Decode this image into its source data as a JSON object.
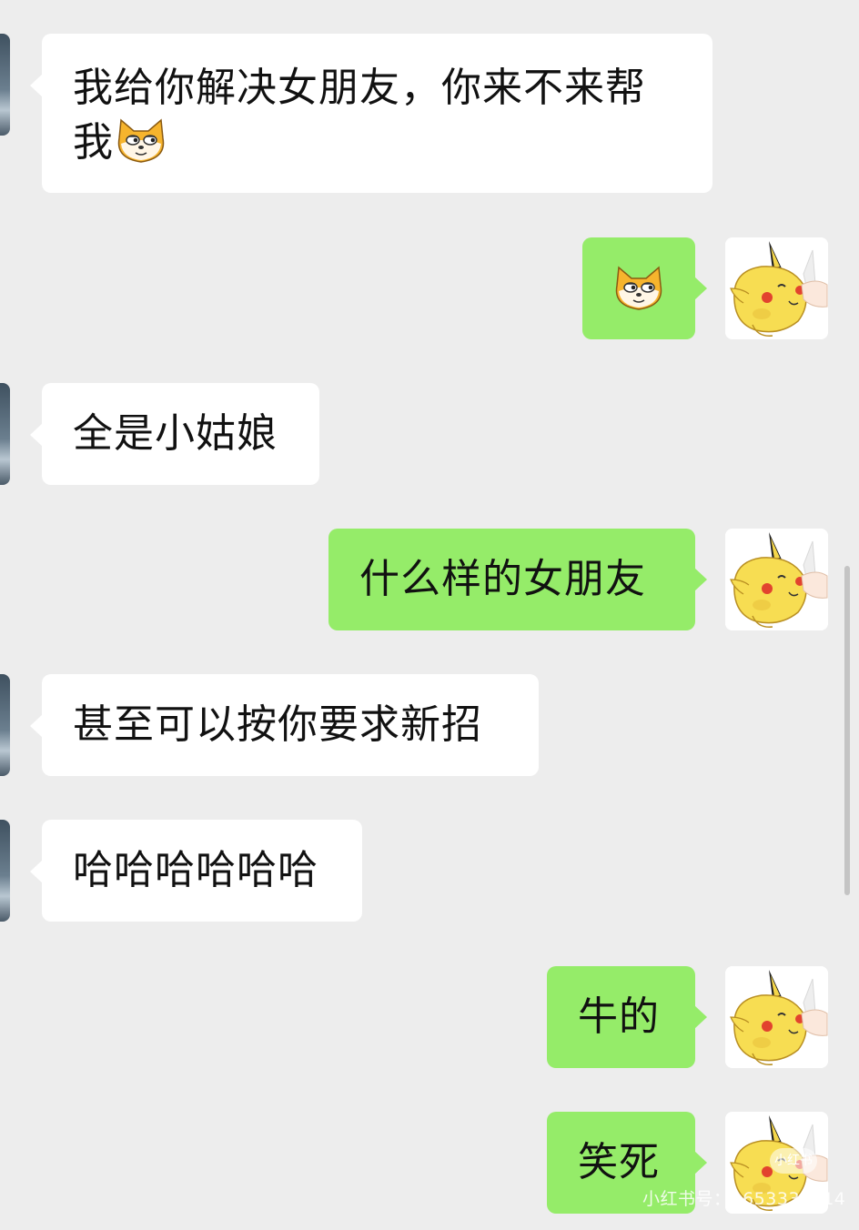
{
  "messages": [
    {
      "side": "in",
      "text_line1": "我给你解决女朋友，你来不来帮",
      "text_line2": "我",
      "emoji": "doge-emoji"
    },
    {
      "side": "out",
      "emoji": "doge-emoji"
    },
    {
      "side": "in",
      "text": "全是小姑娘"
    },
    {
      "side": "out",
      "text": "什么样的女朋友"
    },
    {
      "side": "in",
      "text": "甚至可以按你要求新招"
    },
    {
      "side": "in",
      "text": "哈哈哈哈哈哈"
    },
    {
      "side": "out",
      "text": "牛的"
    },
    {
      "side": "out",
      "text": "笑死"
    }
  ],
  "avatars": {
    "left": "contact-avatar",
    "right": "pikachu-avatar"
  },
  "watermark": {
    "text": "小红书号：1653337814",
    "badge": "小红书"
  },
  "colors": {
    "background": "#ededed",
    "incoming": "#ffffff",
    "outgoing": "#95ec69"
  }
}
